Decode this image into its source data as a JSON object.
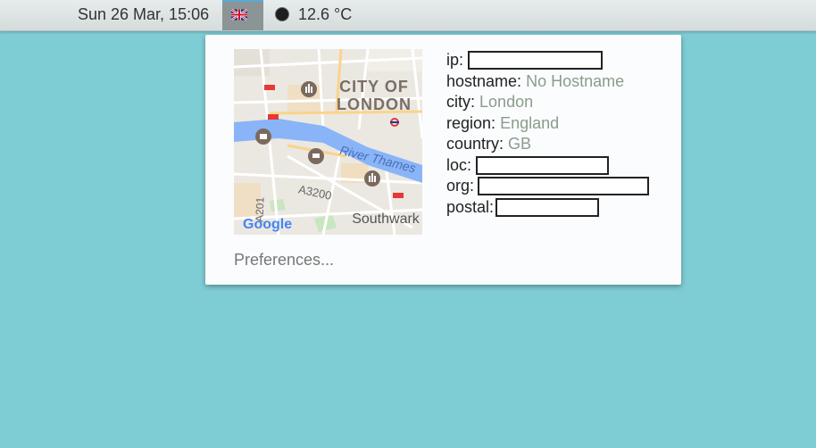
{
  "topbar": {
    "datetime": "Sun 26 Mar, 15:06",
    "flag_icon": "uk-flag-icon",
    "weather_icon": "moon-icon",
    "temperature": "12.6 °C"
  },
  "popup": {
    "map": {
      "labels": {
        "city_line1": "CITY OF",
        "city_line2": "LONDON",
        "river": "River Thames",
        "road_a3200": "A3200",
        "road_a201": "A201",
        "district": "Southwark",
        "brand": "Google"
      },
      "colors": {
        "water": "#8ab4f8",
        "land": "#ebe8e2",
        "roads": "#ffffff",
        "major_road": "#fbd38a"
      }
    },
    "fields": {
      "ip": {
        "key": "ip:",
        "value": ""
      },
      "hostname": {
        "key": "hostname:",
        "value": "No Hostname"
      },
      "city": {
        "key": "city:",
        "value": "London"
      },
      "region": {
        "key": "region:",
        "value": "England"
      },
      "country": {
        "key": "country:",
        "value": "GB"
      },
      "loc": {
        "key": "loc:",
        "value": ""
      },
      "org": {
        "key": "org:",
        "value": ""
      },
      "postal": {
        "key": "postal:",
        "value": ""
      }
    },
    "preferences_label": "Preferences..."
  }
}
